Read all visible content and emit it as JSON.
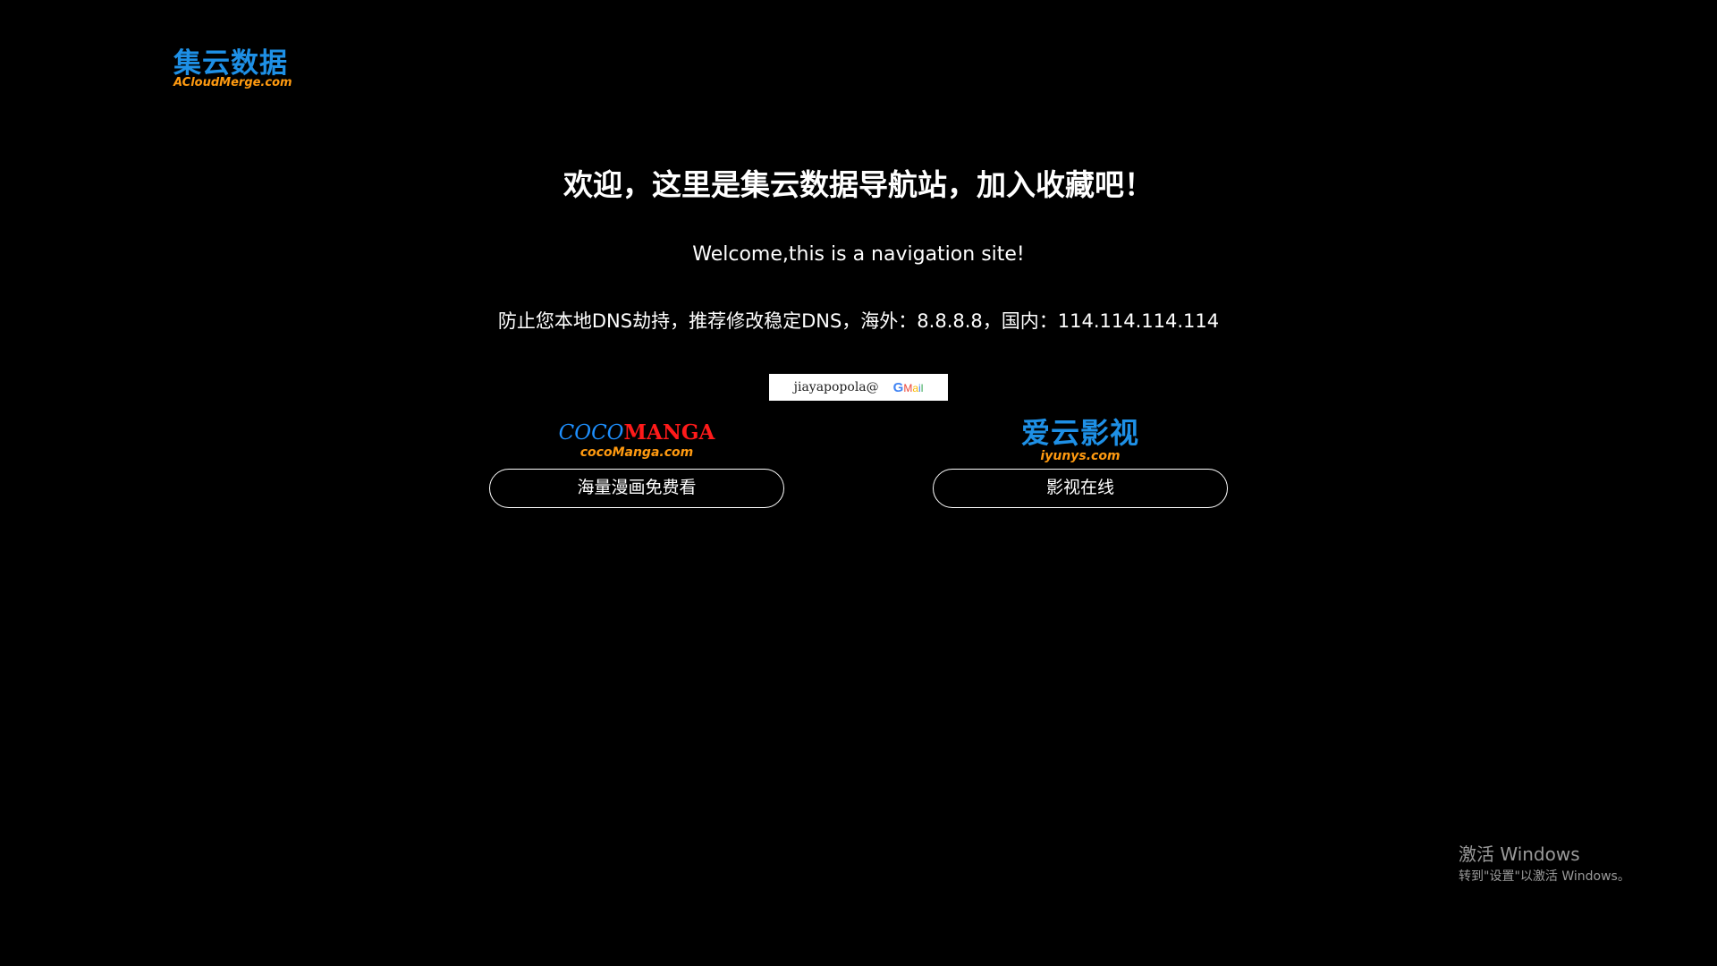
{
  "site": {
    "logo_cn": "集云数据",
    "logo_en": "ACloudMerge.com"
  },
  "main": {
    "headline": "欢迎，这里是集云数据导航站，加入收藏吧！",
    "subtitle": "Welcome,this is a navigation site!",
    "dns_note": "防止您本地DNS劫持，推荐修改稳定DNS，海外：8.8.8.8，国内：114.114.114.114"
  },
  "contact": {
    "email_user": "jiayapopola@",
    "email_provider": "Gmail"
  },
  "cards": [
    {
      "logo_part1": "COCO",
      "logo_part2": "MANGA",
      "logo_sub": "cocoManga.com",
      "button_label": "海量漫画免费看"
    },
    {
      "logo_title": "爱云影视",
      "logo_sub": "iyunys.com",
      "button_label": "影视在线"
    }
  ],
  "watermark": {
    "title": "激活 Windows",
    "subtitle": "转到\"设置\"以激活 Windows。"
  },
  "colors": {
    "background": "#000000",
    "logo_blue": "#1e90e6",
    "logo_orange": "#ff9a10",
    "manga_red": "#ff1a1a",
    "text": "#ffffff",
    "watermark": "#9a9a9a"
  }
}
